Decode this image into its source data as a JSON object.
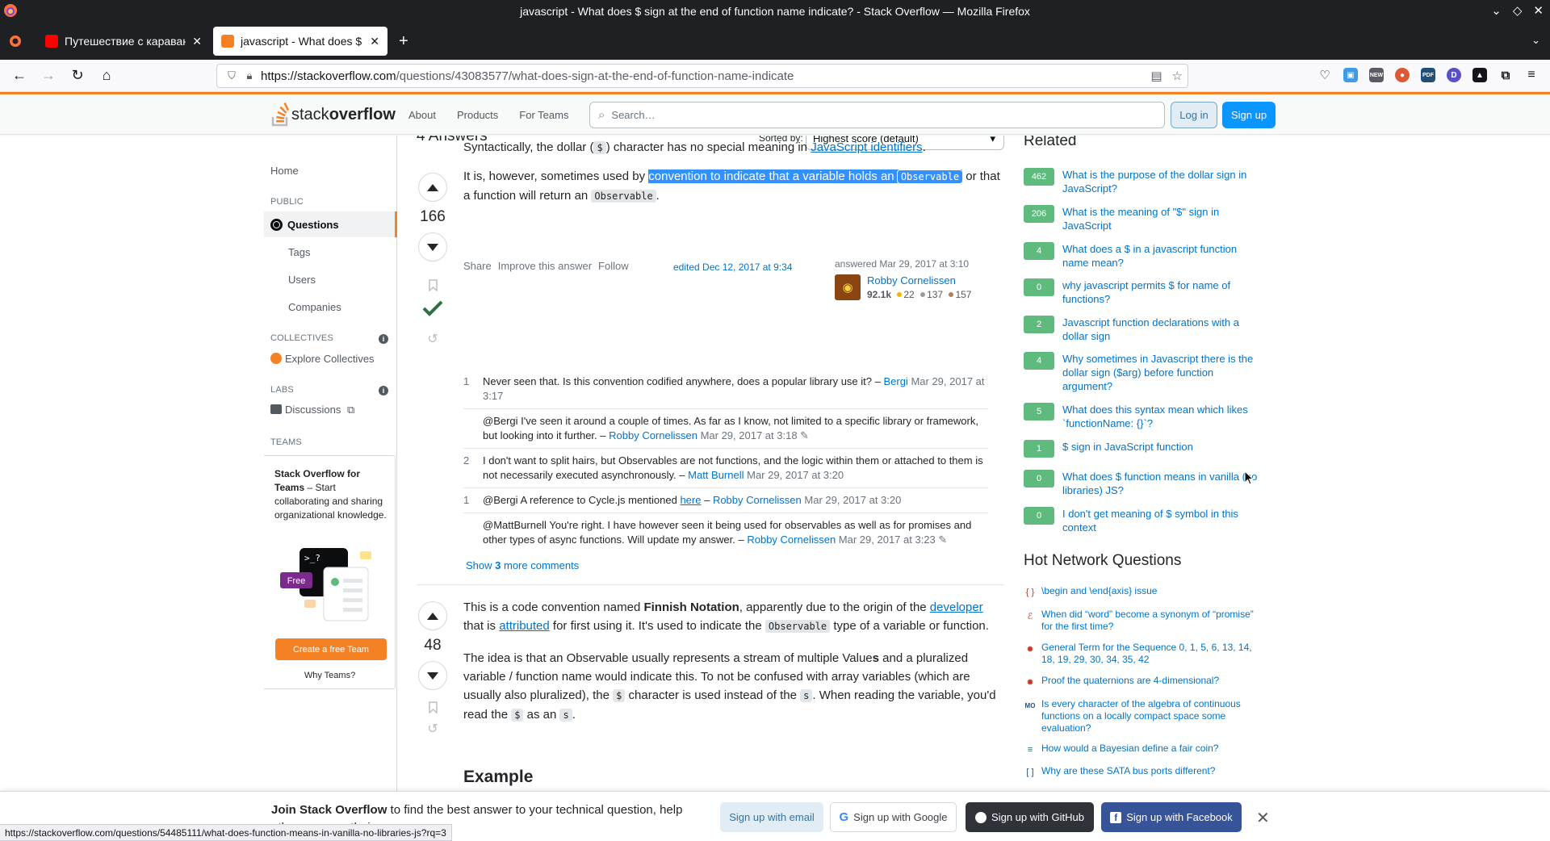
{
  "window": {
    "title": "javascript - What does $ sign at the end of function name indicate? - Stack Overflow — Mozilla Firefox"
  },
  "tabs": [
    {
      "title": "Путешествие с караваном",
      "close": "✕"
    },
    {
      "title": "javascript - What does $ sign",
      "close": "✕"
    }
  ],
  "newtab": "+",
  "url": {
    "host": "https://stackoverflow.com",
    "path": "/questions/43083577/what-does-sign-at-the-end-of-function-name-indicate"
  },
  "ext_labels": {
    "new": "NEW",
    "pdf": "PDF",
    "d": "D"
  },
  "so_header": {
    "logo_plain": "stack",
    "logo_bold": "overflow",
    "nav": [
      "About",
      "Products",
      "For Teams"
    ],
    "search_placeholder": "Search…",
    "login": "Log in",
    "signup": "Sign up"
  },
  "leftnav": {
    "home": "Home",
    "public": "PUBLIC",
    "questions": "Questions",
    "tags": "Tags",
    "users": "Users",
    "companies": "Companies",
    "collectives": "COLLECTIVES",
    "explore": "Explore Collectives",
    "labs": "LABS",
    "discussions": "Discussions",
    "teams_head": "TEAMS",
    "teams_title_bold": "Stack Overflow for Teams",
    "teams_title_rest": " – Start collaborating and sharing organizational knowledge.",
    "free": "Free",
    "prompt": ">_?",
    "create_team": "Create a free Team",
    "why_teams": "Why Teams?"
  },
  "main": {
    "answers_count": "4 Answers",
    "sorted_by": "Sorted by:",
    "sort_value": "Highest score (default)",
    "answer1": {
      "score": "166",
      "p1_a": "Syntactically, the dollar (",
      "p1_code": "$",
      "p1_b": ") character has no special meaning in ",
      "p1_link": "JavaScript identifiers",
      "p1_c": ".",
      "p2_a": "It is, however, sometimes used by ",
      "p2_sel": "convention to indicate that a variable holds an ",
      "p2_code1": "Observable",
      "p2_b": " or that a function will return an ",
      "p2_code2": "Observable",
      "p2_c": ".",
      "share": "Share",
      "improve": "Improve this answer",
      "follow": "Follow",
      "edited": "edited Dec 12, 2017 at 9:34",
      "answered": "answered Mar 29, 2017 at 3:10",
      "user": "Robby Cornelissen",
      "rep": "92.1k",
      "gold": "22",
      "silver": "137",
      "bronze": "157",
      "comments": [
        {
          "score": "1",
          "text": "Never seen that. Is this convention codified anywhere, does a popular library use it?",
          "dash": " – ",
          "user": "Bergi",
          "date": " Mar 29, 2017 at 3:17"
        },
        {
          "score": "",
          "text": "@Bergi I've seen it around a couple of times. As far as I know, not limited to a specific library or framework, but looking into it further.",
          "dash": " – ",
          "user": "Robby Cornelissen",
          "date": " Mar 29, 2017 at 3:18",
          "edit": " ✎"
        },
        {
          "score": "2",
          "text": "I don't want to split hairs, but Observables are not functions, and the logic within them or attached to them is not necessarily executed asynchronously.",
          "dash": " – ",
          "user": "Matt Burnell",
          "date": " Mar 29, 2017 at 3:20"
        },
        {
          "score": "1",
          "text_a": "@Bergi A reference to Cycle.js mentioned ",
          "link": "here",
          "dash": " – ",
          "user": "Robby Cornelissen",
          "date": " Mar 29, 2017 at 3:20"
        },
        {
          "score": "",
          "text": "@MattBurnell You're right. I have however seen it being used for observables as well as for promises and other types of async functions. Will update my answer.",
          "dash": " – ",
          "user": "Robby Cornelissen",
          "date": " Mar 29, 2017 at 3:23",
          "edit": " ✎"
        }
      ],
      "show_more_a": "Show ",
      "show_more_b": "3",
      "show_more_c": " more comments"
    },
    "answer2": {
      "score": "48",
      "p1_a": "This is a code convention named ",
      "p1_bold": "Finnish Notation",
      "p1_b": ", apparently due to the origin of the ",
      "p1_link1": "developer",
      "p1_c": " that is ",
      "p1_link2": "attributed",
      "p1_d": " for first using it. It's used to indicate the ",
      "p1_code": "Observable",
      "p1_e": " type of a variable or function.",
      "p2_a": "The idea is that an Observable usually represents a stream of multiple Value",
      "p2_bold": "s",
      "p2_b": " and a pluralized variable / function name would indicate this. To not be confused with array variables (which are usually also pluralized), the ",
      "p2_code1": "$",
      "p2_c": " character is used instead of the ",
      "p2_code2": "s",
      "p2_d": ". When reading the variable, you'd read the ",
      "p2_code3": "$",
      "p2_e": " as an ",
      "p2_code4": "s",
      "p2_f": ".",
      "example": "Example"
    }
  },
  "related": {
    "title": "Related",
    "items": [
      {
        "score": "462",
        "text": "What is the purpose of the dollar sign in JavaScript?"
      },
      {
        "score": "206",
        "text": "What is the meaning of \"$\" sign in JavaScript"
      },
      {
        "score": "4",
        "text": "What does a $ in a javascript function name mean?"
      },
      {
        "score": "0",
        "text": "why javascript permits $ for name of functions?"
      },
      {
        "score": "2",
        "text": "Javascript function declarations with a dollar sign"
      },
      {
        "score": "4",
        "text": "Why sometimes in Javascript there is the dollar sign ($arg) before function argument?"
      },
      {
        "score": "5",
        "text": "What does this syntax mean which likes `functionName: {}`?"
      },
      {
        "score": "1",
        "text": "$ sign in JavaScript function"
      },
      {
        "score": "0",
        "text": "What does $ function means in vanilla (no libraries) JS?"
      },
      {
        "score": "0",
        "text": "I don't get meaning of $ symbol in this context"
      }
    ]
  },
  "hot": {
    "title": "Hot Network Questions",
    "items": [
      {
        "text": "\\begin and \\end{axis} issue",
        "icon": "{ }",
        "color": "#c0392b"
      },
      {
        "text": "When did “word” become a synonym of “promise” for the first time?",
        "icon": "ℰ",
        "color": "#b03a2e"
      },
      {
        "text": "General Term for the Sequence 0, 1, 5, 6, 13, 14, 18, 19, 29, 30, 34, 35, 42",
        "icon": "✹",
        "color": "#c0392b"
      },
      {
        "text": "Proof the quaternions are 4-dimensional?",
        "icon": "✹",
        "color": "#c0392b"
      },
      {
        "text": "Is every character of the algebra of continuous functions on a locally compact space some evaluation?",
        "icon": "MO",
        "color": "#1f4e79"
      },
      {
        "text": "How would a Bayesian define a fair coin?",
        "icon": "≡",
        "color": "#2c6e49"
      },
      {
        "text": "Why are these SATA bus ports different?",
        "icon": "[ ]",
        "color": "#1f4e79"
      }
    ]
  },
  "join": {
    "bold": "Join Stack Overflow",
    "rest": " to find the best answer to your technical question, help others answer theirs.",
    "email": "Sign up with email",
    "google": "Sign up with Google",
    "github": "Sign up with GitHub",
    "facebook": "Sign up with Facebook"
  },
  "status_url": "https://stackoverflow.com/questions/54485111/what-does-function-means-in-vanilla-no-libraries-js?rq=3",
  "colors": {
    "so_orange": "#f48225",
    "so_blue": "#0a95ff",
    "accepted": "#2f6f44",
    "related_score": "#5eba7d"
  }
}
